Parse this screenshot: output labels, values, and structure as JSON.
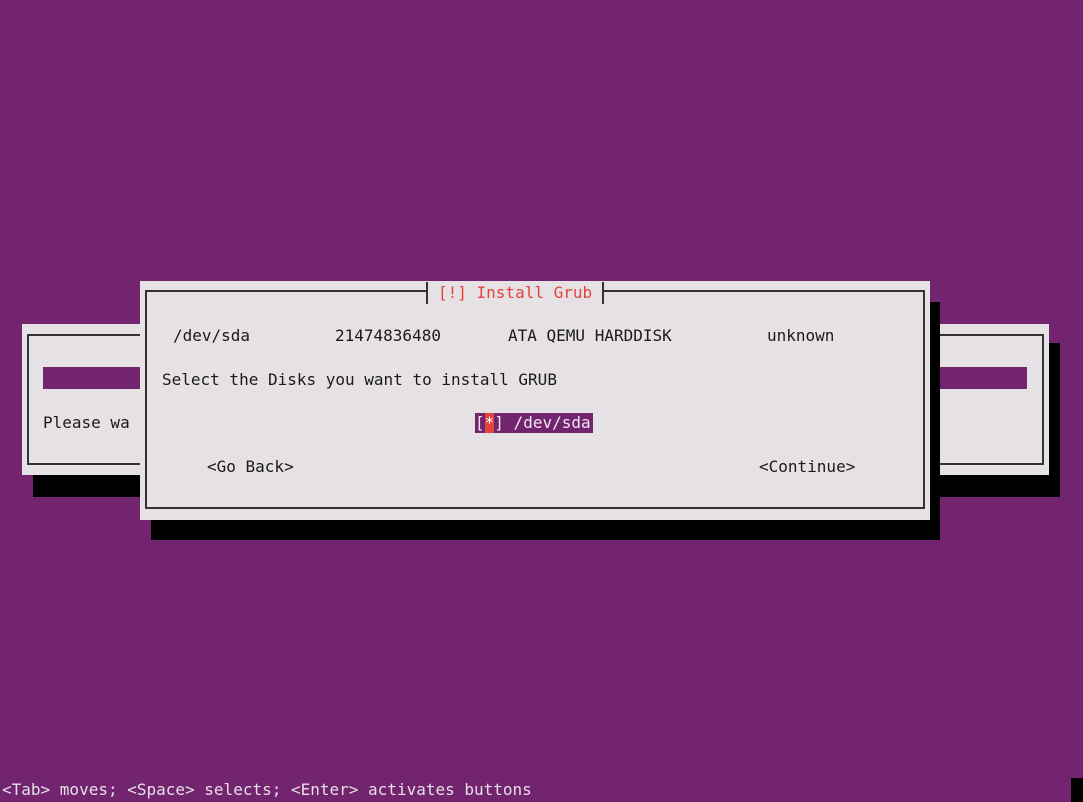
{
  "background_dialog": {
    "text": "Please wa",
    "progress_color": "#72246f"
  },
  "dialog": {
    "title": "[!] Install Grub",
    "title_color": "#e2443b",
    "disk": {
      "path": "/dev/sda",
      "size": "21474836480",
      "model": "ATA QEMU HARDDISK",
      "status": "unknown"
    },
    "prompt": "Select the Disks you want to install GRUB",
    "options": [
      {
        "open": "[",
        "mark": "*",
        "close": "]",
        "label": " /dev/sda",
        "checked": true
      }
    ],
    "buttons": {
      "back": "<Go Back>",
      "continue": "<Continue>"
    }
  },
  "status_bar": {
    "hint": "<Tab> moves; <Space> selects; <Enter> activates buttons"
  },
  "colors": {
    "background": "#72246f",
    "panel": "#e6e1e5",
    "accent": "#e2443b"
  }
}
